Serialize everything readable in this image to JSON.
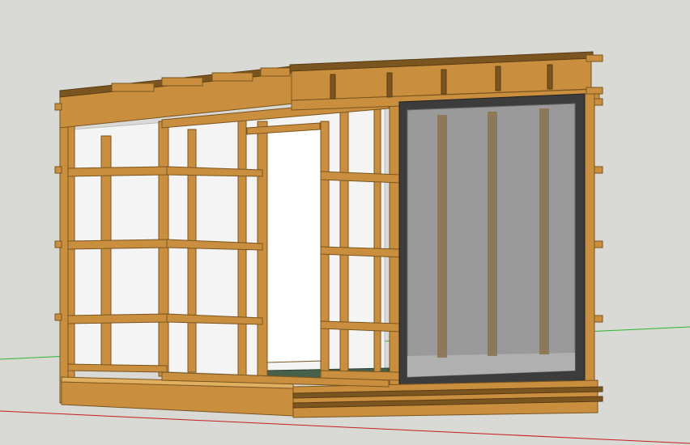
{
  "viewport": {
    "background": "#d9d9d6",
    "axis_colors": {
      "green": "#2fb52f",
      "red": "#c81e1e"
    }
  },
  "model": {
    "subject": "timber-framed-shed-with-glazed-door",
    "wood_color": "#c98f3e",
    "wood_dark": "#7a5520",
    "wood_light": "#e0b060",
    "glass_color": "#f4f4f4",
    "door_glass_color": "#9a9a9a",
    "door_frame_color": "#3c3c3c",
    "floor_color": "#46604a"
  }
}
